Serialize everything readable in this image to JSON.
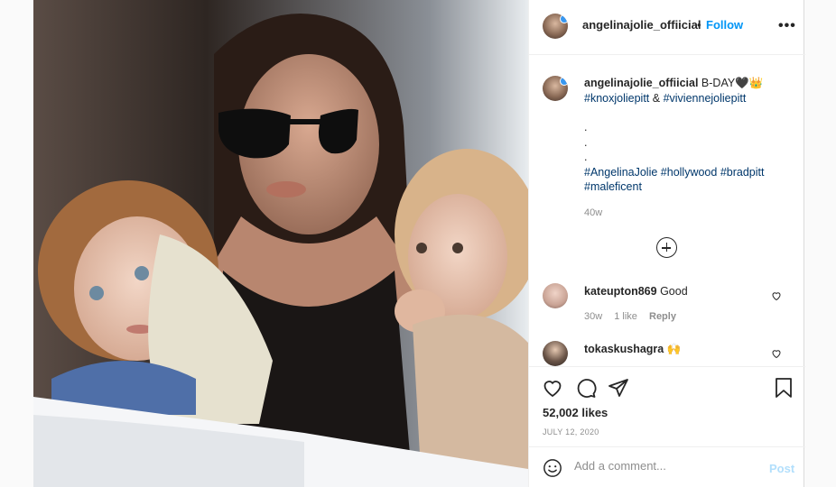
{
  "post": {
    "username": "angelinajolie_offiicial",
    "follow_label": "Follow",
    "separator": "•",
    "more_icon": "more-horizontal-icon",
    "caption": {
      "username": "angelinajolie_offiicial",
      "text": "B-DAY🖤👑",
      "line2_tag1": "#knoxjoliepitt",
      "line2_amp": "&",
      "line2_tag2": "#viviennejoliepitt",
      "dots": [
        ".",
        ".",
        "."
      ],
      "tags": [
        "#AngelinaJolie",
        "#hollywood",
        "#bradpitt",
        "#maleficent"
      ]
    },
    "age": "40w",
    "load_more_icon": "plus-circle-icon"
  },
  "comments": [
    {
      "username": "kateupton869",
      "text": "Good",
      "age": "30w",
      "likes": "1 like",
      "reply": "Reply"
    },
    {
      "username": "tokaskushagra",
      "text": "🙌"
    }
  ],
  "actions": {
    "icons": [
      "heart-icon",
      "comment-icon",
      "share-icon",
      "bookmark-icon"
    ],
    "likes": "52,002 likes",
    "date": "JULY 12, 2020"
  },
  "add_comment": {
    "placeholder": "Add a comment...",
    "post_label": "Post",
    "emoji_icon": "emoji-icon"
  },
  "colors": {
    "accent": "#0095f6",
    "post_disabled": "#b2dffc",
    "hashtag": "#00376b",
    "muted": "#8e8e8e"
  }
}
